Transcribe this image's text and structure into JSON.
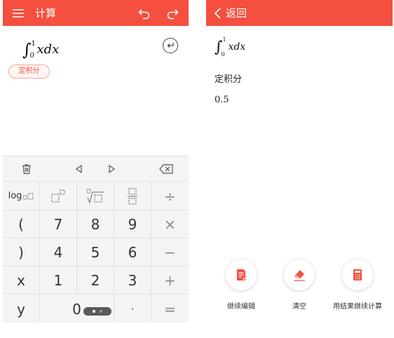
{
  "left_screen": {
    "header": {
      "title": "计算",
      "icons": [
        "menu-icon",
        "undo-icon",
        "redo-icon"
      ]
    },
    "expression": {
      "lower_limit": "0",
      "upper_limit": "1",
      "body": "xdx"
    },
    "mode_tag": "定积分",
    "keyboard": {
      "top_row": [
        "trash-icon",
        "cursor-left-icon",
        "cursor-right-icon",
        "backspace-icon"
      ],
      "keys": {
        "log": "log",
        "paren_open": "(",
        "seven": "7",
        "eight": "8",
        "nine": "9",
        "times": "×",
        "paren_close": ")",
        "four": "4",
        "five": "5",
        "six": "6",
        "minus": "−",
        "x": "x",
        "one": "1",
        "two": "2",
        "three": "3",
        "plus": "+",
        "y": "y",
        "zero": "0",
        "dot": "·",
        "equals": "=",
        "divide": "÷"
      }
    }
  },
  "right_screen": {
    "header": {
      "back_label": "返回"
    },
    "expression": {
      "lower_limit": "0",
      "upper_limit": "1",
      "body": "xdx"
    },
    "result_label": "定积分",
    "result_value": "0.5",
    "actions": [
      {
        "label": "继续编辑",
        "icon": "edit-document-icon"
      },
      {
        "label": "清空",
        "icon": "eraser-icon"
      },
      {
        "label": "用结果继续计算",
        "icon": "calculator-icon"
      }
    ]
  },
  "colors": {
    "accent": "#f44f3f",
    "keyboard_bg": "#f4f4f4",
    "key_border": "#e2e2e2"
  }
}
